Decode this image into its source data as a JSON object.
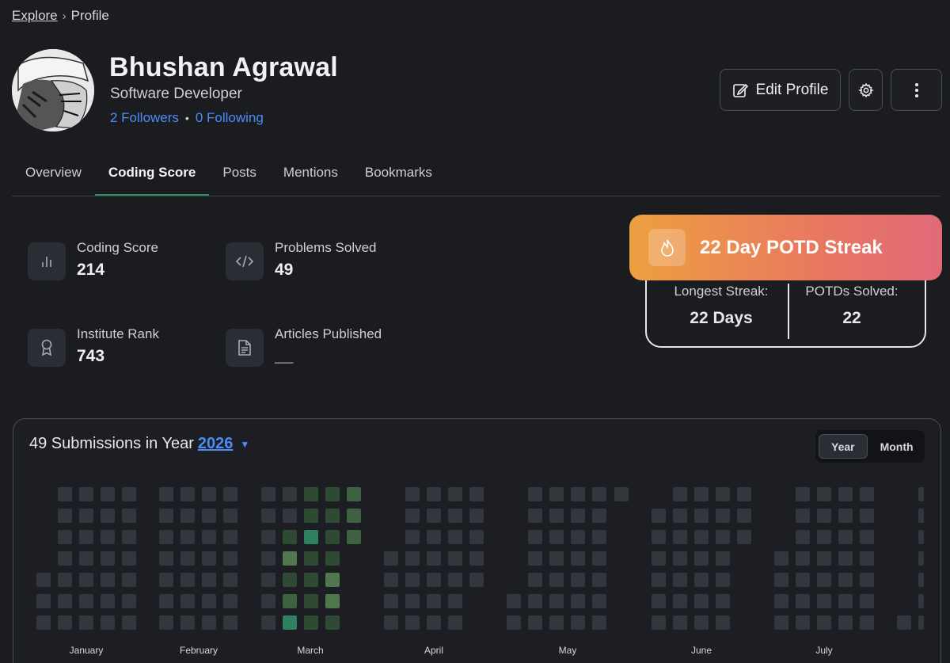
{
  "breadcrumb": {
    "link": "Explore",
    "current": "Profile"
  },
  "profile": {
    "name": "Bhushan Agrawal",
    "role": "Software Developer",
    "followers": "2 Followers",
    "following": "0 Following"
  },
  "actions": {
    "edit_label": "Edit Profile"
  },
  "tabs": [
    {
      "label": "Overview"
    },
    {
      "label": "Coding Score"
    },
    {
      "label": "Posts"
    },
    {
      "label": "Mentions"
    },
    {
      "label": "Bookmarks"
    }
  ],
  "active_tab": "Coding Score",
  "stats": {
    "coding_score": {
      "label": "Coding Score",
      "value": "214",
      "icon": "bar-chart-icon"
    },
    "problems_solved": {
      "label": "Problems Solved",
      "value": "49",
      "icon": "code-icon"
    },
    "institute_rank": {
      "label": "Institute Rank",
      "value": "743",
      "icon": "medal-icon"
    },
    "articles_published": {
      "label": "Articles Published",
      "value": "__",
      "icon": "document-icon"
    }
  },
  "streak": {
    "title": "22 Day POTD Streak",
    "icon": "flame-icon",
    "longest_label": "Longest Streak:",
    "longest_value": "22 Days",
    "solved_label": "POTDs Solved:",
    "solved_value": "22"
  },
  "submissions": {
    "title_prefix": "49 Submissions in Year",
    "year": "2026",
    "view_options": [
      "Year",
      "Month"
    ],
    "selected_view": "Year",
    "months": [
      "January",
      "February",
      "March",
      "April",
      "May",
      "June",
      "July"
    ]
  },
  "colors": {
    "accent": "#2f8d5e",
    "link": "#4c8df6",
    "empty_cell": "#33363d",
    "level1": "#2f4a32",
    "level2": "#3e6140",
    "level3": "#51774f",
    "level4": "#2e8060",
    "streak_from": "#eea040",
    "streak_to": "#e06a78"
  }
}
